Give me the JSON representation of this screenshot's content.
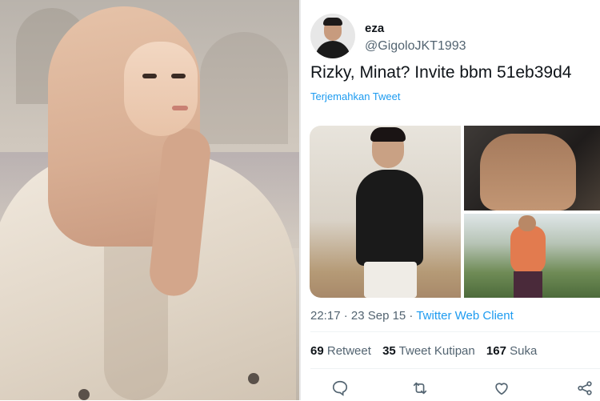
{
  "tweet": {
    "display_name": "eza",
    "handle": "@GigoloJKT1993",
    "text": "Rizky, Minat? Invite bbm 51eb39d4",
    "translate_label": "Terjemahkan Tweet",
    "time": "22:17 · 23 Sep 15 · ",
    "client": "Twitter Web Client",
    "stats": {
      "retweets_count": "69",
      "retweets_label": "Retweet",
      "quotes_count": "35",
      "quotes_label": "Tweet Kutipan",
      "likes_count": "167",
      "likes_label": "Suka"
    },
    "actions": [
      "reply-icon",
      "retweet-icon",
      "like-icon",
      "share-icon"
    ]
  },
  "colors": {
    "link": "#1d9bf0",
    "secondary_text": "#536471",
    "primary_text": "#0f1419"
  }
}
